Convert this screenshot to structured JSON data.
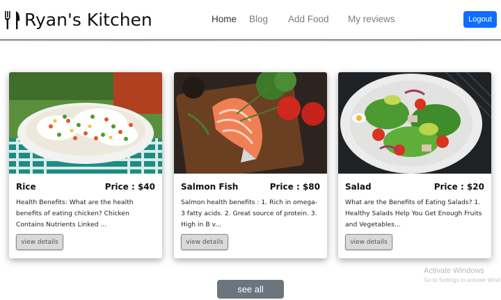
{
  "brand": {
    "name": "Ryan's Kitchen",
    "icon": "fork-knife-icon"
  },
  "nav": {
    "links": [
      "Home",
      "Blog",
      "Add Food",
      "My reviews"
    ],
    "active": "Home",
    "logout_label": "Logout"
  },
  "colors": {
    "primary": "#0d6efd",
    "secondary": "#6c757d"
  },
  "foods": [
    {
      "name": "Rice",
      "price": "Price : $40",
      "description": "Health Benefits: What are the health benefits of eating chicken? Chicken Contains Nutrients Linked ...",
      "button": "view details"
    },
    {
      "name": "Salmon Fish",
      "price": "Price : $80",
      "description": "Salmon health benefits : 1. Rich in omega-3 fatty acids. 2. Great source of protein. 3. High in B v...",
      "button": "view details"
    },
    {
      "name": "Salad",
      "price": "Price : $20",
      "description": "What are the Benefits of Eating Salads? 1. Healthy Salads Help You Get Enough Fruits and Vegetables...",
      "button": "view details"
    }
  ],
  "see_all_label": "see all",
  "watermark": {
    "title": "Activate Windows",
    "subtitle": "Go to Settings to activate Wind"
  }
}
